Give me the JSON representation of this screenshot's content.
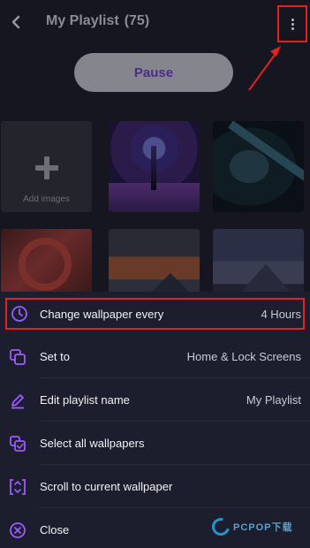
{
  "header": {
    "title": "My Playlist",
    "count": "(75)"
  },
  "controls": {
    "pause_label": "Pause"
  },
  "grid": {
    "add_images_label": "Add images"
  },
  "menu": {
    "items": [
      {
        "label": "Change wallpaper every",
        "value": "4 Hours",
        "icon": "clock-icon"
      },
      {
        "label": "Set to",
        "value": "Home & Lock Screens",
        "icon": "copy-screens-icon"
      },
      {
        "label": "Edit playlist name",
        "value": "My Playlist",
        "icon": "pencil-icon"
      },
      {
        "label": "Select all wallpapers",
        "value": "",
        "icon": "select-all-icon"
      },
      {
        "label": "Scroll to current wallpaper",
        "value": "",
        "icon": "scroll-focus-icon"
      },
      {
        "label": "Close",
        "value": "",
        "icon": "close-circle-icon"
      }
    ]
  },
  "watermark": {
    "text": "PCPOP下载"
  },
  "colors": {
    "accent": "#9b5cff",
    "highlight_border": "#e02222",
    "sheet_background": "#1d1e2d"
  }
}
